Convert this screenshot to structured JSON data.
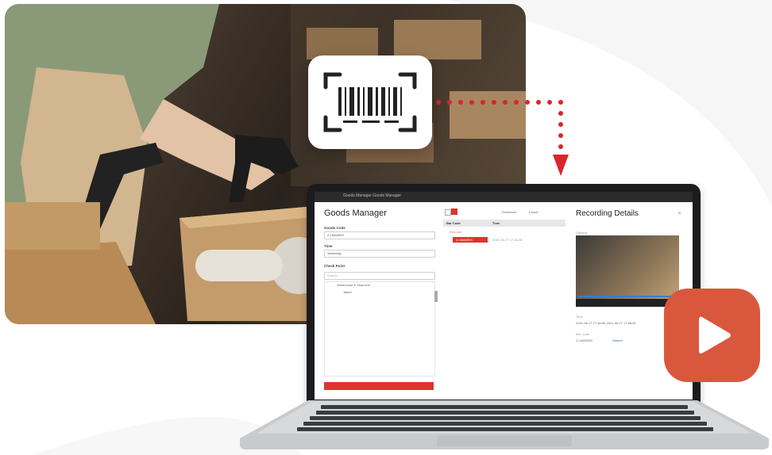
{
  "app": {
    "window_title": "Goods Manager Goods Manager",
    "title": "Goods Manager"
  },
  "form": {
    "goods_code_label": "Goods Code",
    "goods_code_value": "2-LMA0993",
    "time_label": "Time",
    "time_value": "Yesterday",
    "check_point_label": "Check Point",
    "search_placeholder": "Search",
    "tree": [
      "Warehouse & Shipment",
      "Tablet"
    ]
  },
  "list": {
    "download_label": "Download",
    "export_label": "Export",
    "columns": [
      "Bar Code",
      "Time"
    ],
    "group_label": "Barcode",
    "selected_row": {
      "code": "2-LMA0993",
      "time": "2021-06-17 17:38:06"
    }
  },
  "details": {
    "title": "Recording Details",
    "video_label": "Camera",
    "time_label": "Time",
    "time_value": "2021-06-17 17:38:06-2021-06-17 17:38:06",
    "barcode_label": "Bar Code",
    "barcode_value": "2-LMA0993",
    "search_link": "Search"
  },
  "colors": {
    "accent_red": "#e0322f",
    "play_orange": "#d9583d",
    "dotted_red": "#d9262b"
  }
}
